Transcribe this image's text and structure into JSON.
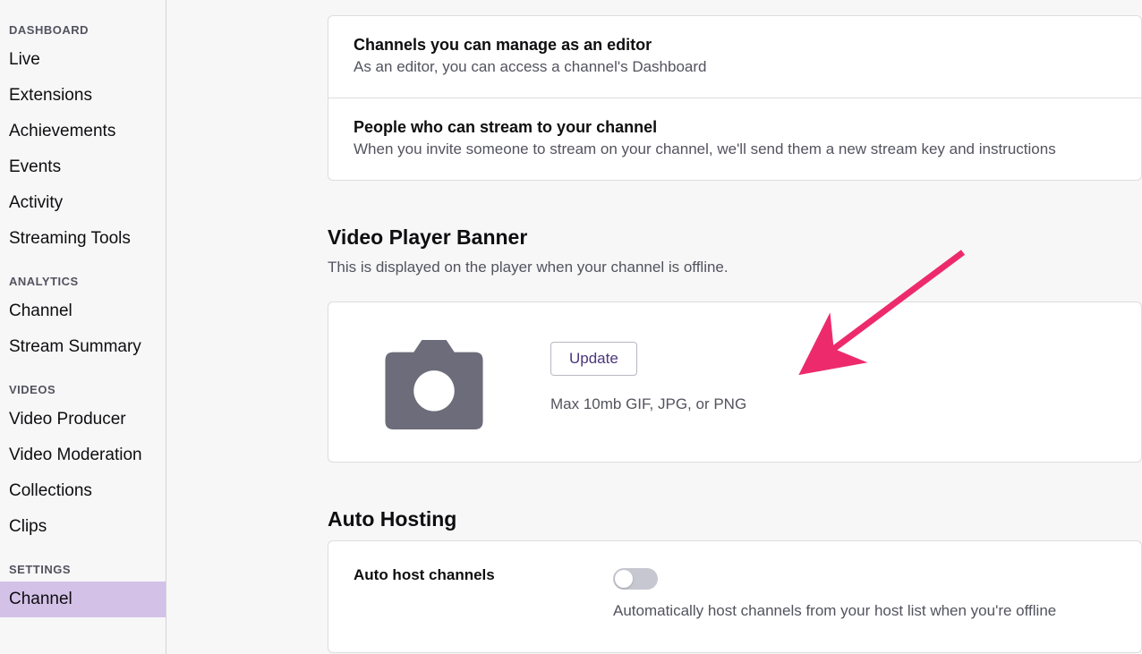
{
  "sidebar": {
    "groups": [
      {
        "header": "DASHBOARD",
        "items": [
          {
            "label": "Live"
          },
          {
            "label": "Extensions"
          },
          {
            "label": "Achievements"
          },
          {
            "label": "Events"
          },
          {
            "label": "Activity"
          },
          {
            "label": "Streaming Tools"
          }
        ]
      },
      {
        "header": "ANALYTICS",
        "items": [
          {
            "label": "Channel"
          },
          {
            "label": "Stream Summary"
          }
        ]
      },
      {
        "header": "VIDEOS",
        "items": [
          {
            "label": "Video Producer"
          },
          {
            "label": "Video Moderation"
          },
          {
            "label": "Collections"
          },
          {
            "label": "Clips"
          }
        ]
      },
      {
        "header": "SETTINGS",
        "items": [
          {
            "label": "Channel",
            "active": true
          }
        ]
      }
    ]
  },
  "card1": {
    "title": "Channels you can manage as an editor",
    "desc": "As an editor, you can access a channel's Dashboard"
  },
  "card2": {
    "title": "People who can stream to your channel",
    "desc": "When you invite someone to stream on your channel, we'll send them a new stream key and instructions"
  },
  "banner_section": {
    "title": "Video Player Banner",
    "desc": "This is displayed on the player when your channel is offline.",
    "update_label": "Update",
    "hint": "Max 10mb GIF, JPG, or PNG"
  },
  "autohost_section": {
    "title": "Auto Hosting",
    "row_label": "Auto host channels",
    "desc": "Automatically host channels from your host list when you're offline"
  }
}
